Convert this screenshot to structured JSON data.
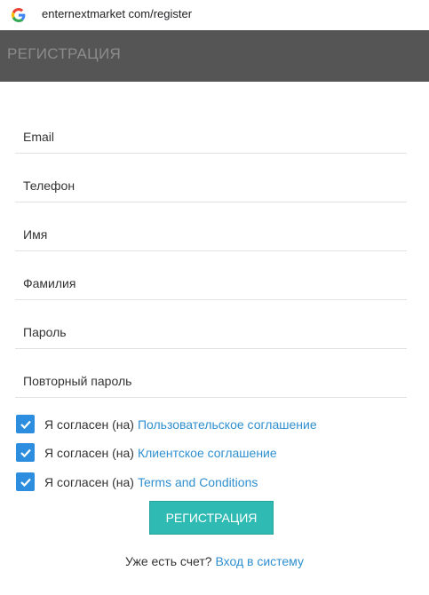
{
  "browser": {
    "url": "enternextmarket com/register",
    "icon": "google-g-icon"
  },
  "header": {
    "title": "РЕГИСТРАЦИЯ",
    "background": "#555555"
  },
  "form": {
    "fields": [
      {
        "placeholder": "Email",
        "value": ""
      },
      {
        "placeholder": "Телефон",
        "value": ""
      },
      {
        "placeholder": "Имя",
        "value": ""
      },
      {
        "placeholder": "Фамилия",
        "value": ""
      },
      {
        "placeholder": "Пароль",
        "value": ""
      },
      {
        "placeholder": "Повторный пароль",
        "value": ""
      }
    ],
    "agreements": [
      {
        "prefix": "Я согласен (на)",
        "link": "Пользовательское соглашение",
        "checked": true
      },
      {
        "prefix": "Я согласен (на)",
        "link": "Клиентское соглашение",
        "checked": true
      },
      {
        "prefix": "Я согласен (на)",
        "link": "Terms and Conditions",
        "checked": true
      }
    ],
    "submit_label": "РЕГИСТРАЦИЯ",
    "login_prompt": "Уже есть счет?",
    "login_link": "Вход в систему"
  },
  "colors": {
    "accent": "#2fbab4",
    "link": "#2f8fcf",
    "checkbox": "#2d8ee0"
  }
}
